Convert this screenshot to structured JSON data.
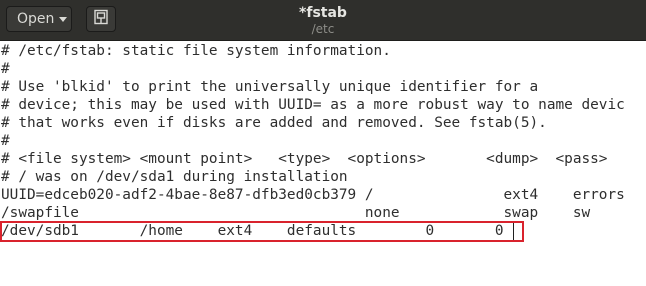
{
  "header": {
    "open_label": "Open",
    "pin_icon": "document-pin-icon",
    "title": "*fstab",
    "subtitle": "/etc"
  },
  "editor": {
    "lines": [
      "# /etc/fstab: static file system information.",
      "#",
      "# Use 'blkid' to print the universally unique identifier for a",
      "# device; this may be used with UUID= as a more robust way to name devic",
      "# that works even if disks are added and removed. See fstab(5).",
      "#",
      "# <file system> <mount point>   <type>  <options>       <dump>  <pass>",
      "# / was on /dev/sda1 during installation",
      "UUID=edceb020-adf2-4bae-8e87-dfb3ed0cb379 /               ext4    errors",
      "/swapfile                                 none            swap    sw",
      "/dev/sdb1       /home    ext4    defaults        0       0"
    ]
  },
  "colors": {
    "header_bg": "#2f2f2c",
    "highlight": "#d9232d"
  }
}
